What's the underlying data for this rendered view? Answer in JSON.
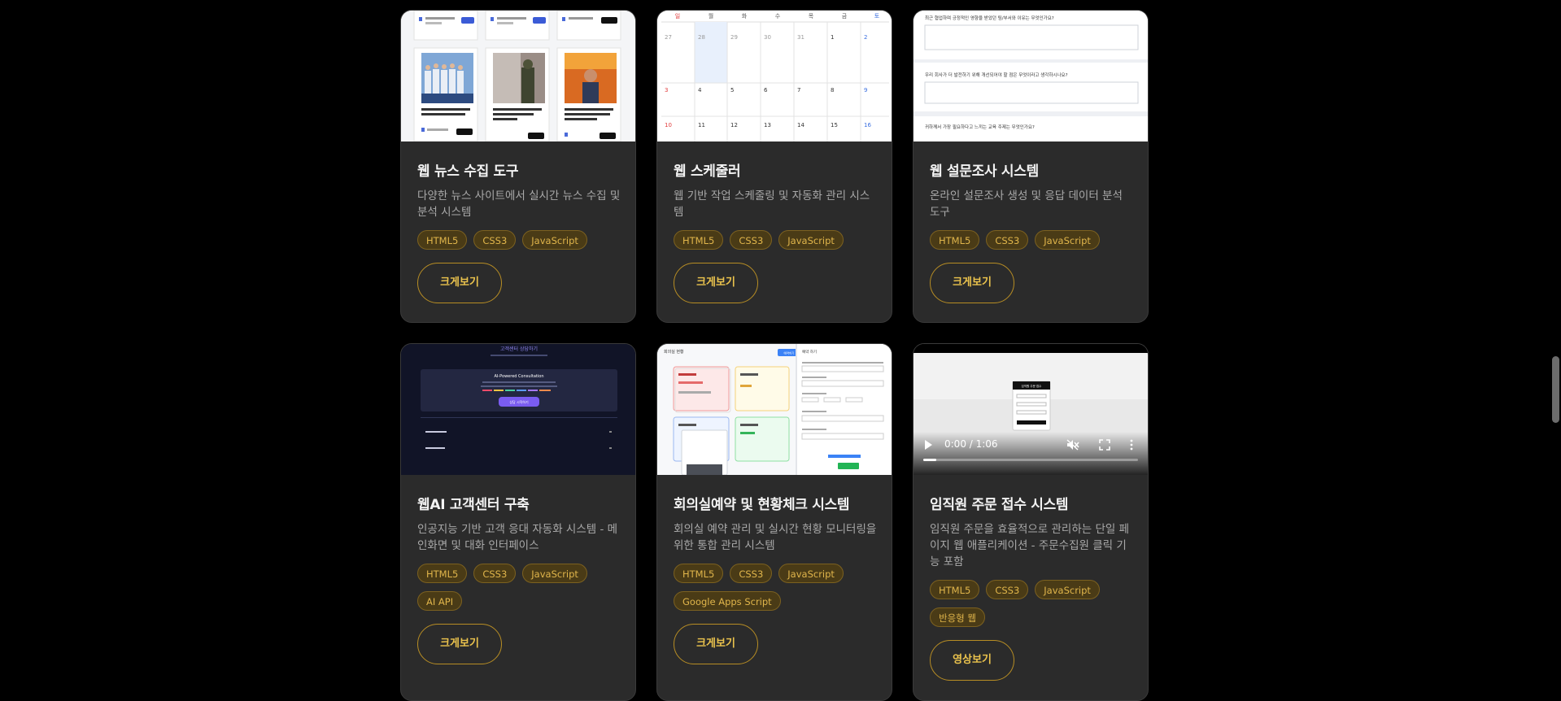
{
  "cards": [
    {
      "title": "웹 뉴스 수집 도구",
      "desc": "다양한 뉴스 사이트에서 실시간 뉴스 수집 및 분석 시스템",
      "tags": [
        "HTML5",
        "CSS3",
        "JavaScript"
      ],
      "button": "크게보기",
      "thumb": {
        "headlines": [
          "대한 '지원 치료' 지역특별 분할, 외교 긴급 생존",
          "지워지고 식량 한국 육사는 '송속감', 경고하는 인생 선택길",
          "마음이 자유함을 회복한 정말에? 열받스럽 이야 대한 행운개념의 정리"
        ]
      }
    },
    {
      "title": "웹 스케줄러",
      "desc": "웹 기반 작업 스케줄링 및 자동화 관리 시스템",
      "tags": [
        "HTML5",
        "CSS3",
        "JavaScript"
      ],
      "button": "크게보기",
      "thumb": {
        "weekdays": [
          "일",
          "월",
          "화",
          "수",
          "목",
          "금",
          "토"
        ],
        "weeks": [
          [
            "27",
            "28",
            "29",
            "30",
            "31",
            "1",
            "2"
          ],
          [
            "3",
            "4",
            "5",
            "6",
            "7",
            "8",
            "9"
          ],
          [
            "10",
            "11",
            "12",
            "13",
            "14",
            "15",
            "16"
          ]
        ]
      }
    },
    {
      "title": "웹 설문조사 시스템",
      "desc": "온라인 설문조사 생성 및 응답 데이터 분석 도구",
      "tags": [
        "HTML5",
        "CSS3",
        "JavaScript"
      ],
      "button": "크게보기",
      "thumb": {
        "questions": [
          "최근 협업하며 긍정적인 영향을 받았던 팀/부서와 이유는 무엇인가요?",
          "우리 회사가 더 발전하기 위해 개선되어야 할 점은 무엇이라고 생각하시나요?",
          "귀하께서 가장 필요하다고 느끼는 교육 주제는 무엇인가요?"
        ]
      }
    },
    {
      "title": "웹AI 고객센터 구축",
      "desc": "인공지능 기반 고객 응대 자동화 시스템 - 메인화면 및 대화 인터페이스",
      "tags": [
        "HTML5",
        "CSS3",
        "JavaScript",
        "AI API"
      ],
      "button": "크게보기",
      "thumb": {
        "heading": "고객센터 상담하기",
        "panel_title": "AI-Powered Consultation",
        "panel_button": "상담 시작하기"
      }
    },
    {
      "title": "회의실예약 및 현황체크 시스템",
      "desc": "회의실 예약 관리 및 실시간 현황 모니터링을 위한 통합 관리 시스템",
      "tags": [
        "HTML5",
        "CSS3",
        "JavaScript",
        "Google Apps Script"
      ],
      "button": "크게보기",
      "thumb": {
        "header": "회의실 현황",
        "action": "예약하기",
        "form_title": "예약 하기"
      }
    },
    {
      "title": "임직원 주문 접수 시스템",
      "desc": "임직원 주문을 효율적으로 관리하는 단일 페이지 웹 애플리케이션 - 주문수집원 클릭 기능 포함",
      "tags": [
        "HTML5",
        "CSS3",
        "JavaScript",
        "반응형 웹"
      ],
      "button": "영상보기",
      "thumb": {
        "video_time": "0:00 / 1:06",
        "panel_title": "임직원 주문 접수"
      }
    }
  ],
  "colors": {
    "background": "#000000",
    "card": "#2b2b2b",
    "accent": "#ebc34d",
    "tag_bg": "#4a3b16"
  }
}
